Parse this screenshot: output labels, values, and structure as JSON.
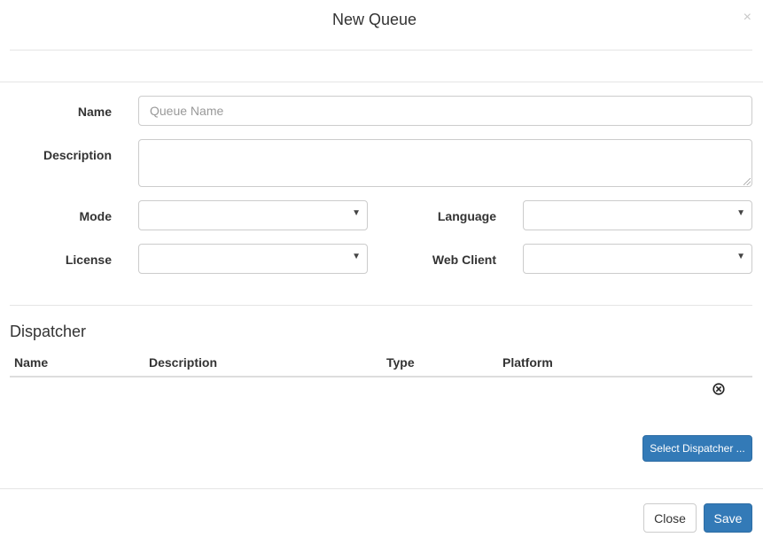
{
  "modal": {
    "title": "New Queue",
    "close_glyph": "×"
  },
  "form": {
    "name_label": "Name",
    "name_placeholder": "Queue Name",
    "name_value": "",
    "description_label": "Description",
    "description_value": "",
    "mode_label": "Mode",
    "mode_value": "",
    "language_label": "Language",
    "language_value": "",
    "license_label": "License",
    "license_value": "",
    "web_client_label": "Web Client",
    "web_client_value": "",
    "caret_glyph": "▼"
  },
  "dispatcher": {
    "title": "Dispatcher",
    "columns": [
      "Name",
      "Description",
      "Type",
      "Platform"
    ],
    "rows": [],
    "remove_icon": "circle-x-icon",
    "select_button": "Select Dispatcher ..."
  },
  "footer": {
    "close_label": "Close",
    "save_label": "Save"
  },
  "colors": {
    "primary": "#337ab7",
    "border": "#cccccc",
    "divider": "#e5e5e5",
    "text": "#333333"
  }
}
